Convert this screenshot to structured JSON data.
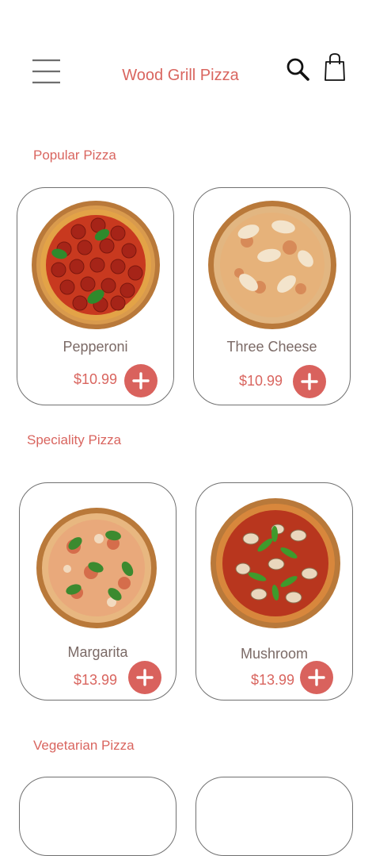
{
  "header": {
    "title": "Wood Grill Pizza",
    "menu_icon": "hamburger-menu-icon",
    "search_icon": "search-icon",
    "cart_icon": "shopping-bag-icon"
  },
  "sections": [
    {
      "title": "Popular Pizza",
      "items": [
        {
          "name": "Pepperoni",
          "price": "$10.99",
          "image": "pepperoni-pizza"
        },
        {
          "name": "Three Cheese",
          "price": "$10.99",
          "image": "three-cheese-pizza"
        }
      ]
    },
    {
      "title": "Speciality Pizza",
      "items": [
        {
          "name": "Margarita",
          "price": "$13.99",
          "image": "margarita-pizza"
        },
        {
          "name": "Mushroom",
          "price": "$13.99",
          "image": "mushroom-pizza"
        }
      ]
    },
    {
      "title": "Vegetarian Pizza"
    }
  ],
  "colors": {
    "accent": "#d9655f",
    "add_button": "#d9625d",
    "card_border": "#707070",
    "item_name": "#7b6a66"
  }
}
